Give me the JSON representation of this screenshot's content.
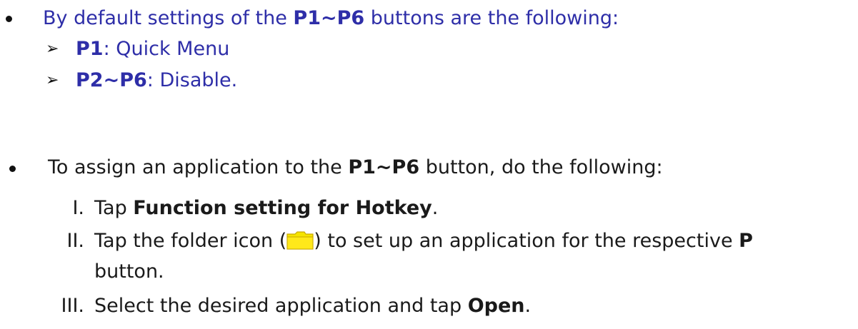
{
  "section1": {
    "intro_prefix": "By default settings of the ",
    "intro_bold": "P1~P6",
    "intro_suffix": " buttons are the following:",
    "items": [
      {
        "bold": "P1",
        "text": ": Quick Menu"
      },
      {
        "bold": "P2~P6",
        "text": ": Disable."
      }
    ]
  },
  "section2": {
    "intro_prefix": "To assign an application to the ",
    "intro_bold": "P1~P6",
    "intro_suffix": " button, do the following:",
    "steps": [
      {
        "num": "I.",
        "prefix": "Tap ",
        "bold": "Function setting for Hotkey",
        "suffix": "."
      },
      {
        "num": "II.",
        "prefix": "Tap the folder icon (",
        "icon": "folder-icon",
        "mid": ") to set up an application for the respective ",
        "bold": "P",
        "cont": "button."
      },
      {
        "num": "III.",
        "prefix": "Select the desired application and tap ",
        "bold": "Open",
        "suffix": "."
      }
    ]
  },
  "colors": {
    "section1_text": "#2e2ea8",
    "section2_text": "#1a1a1a",
    "folder_icon": "#f5e400"
  }
}
